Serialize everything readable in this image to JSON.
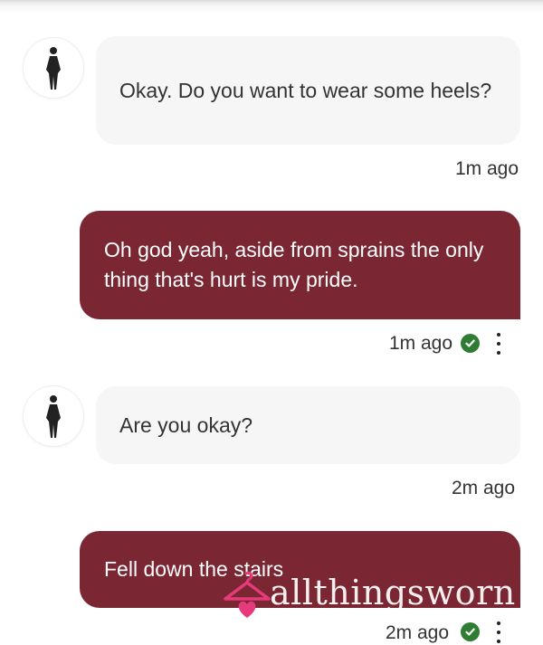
{
  "messages": [
    {
      "direction": "incoming",
      "text": "Okay. Do you want to wear some heels?",
      "time": "1m ago"
    },
    {
      "direction": "outgoing",
      "text": "Oh god yeah, aside from sprains the only thing that's hurt is my pride.",
      "time": "1m ago",
      "status": "read"
    },
    {
      "direction": "incoming",
      "text": "Are you okay?",
      "time": "2m ago"
    },
    {
      "direction": "outgoing",
      "text": "Fell down the stairs",
      "time": "2m ago",
      "status": "read"
    }
  ],
  "icons": {
    "avatar": "person-silhouette-icon",
    "read": "check-circle-icon",
    "menu": "more-vertical-icon"
  },
  "watermark": {
    "text": "allthingsworn",
    "logo": "hanger-heart-logo"
  },
  "colors": {
    "outgoing_bubble": "#7a2733",
    "incoming_bubble": "#f6f6f7",
    "read_check": "#2e7d32",
    "watermark_logo": "#e73a7b"
  }
}
